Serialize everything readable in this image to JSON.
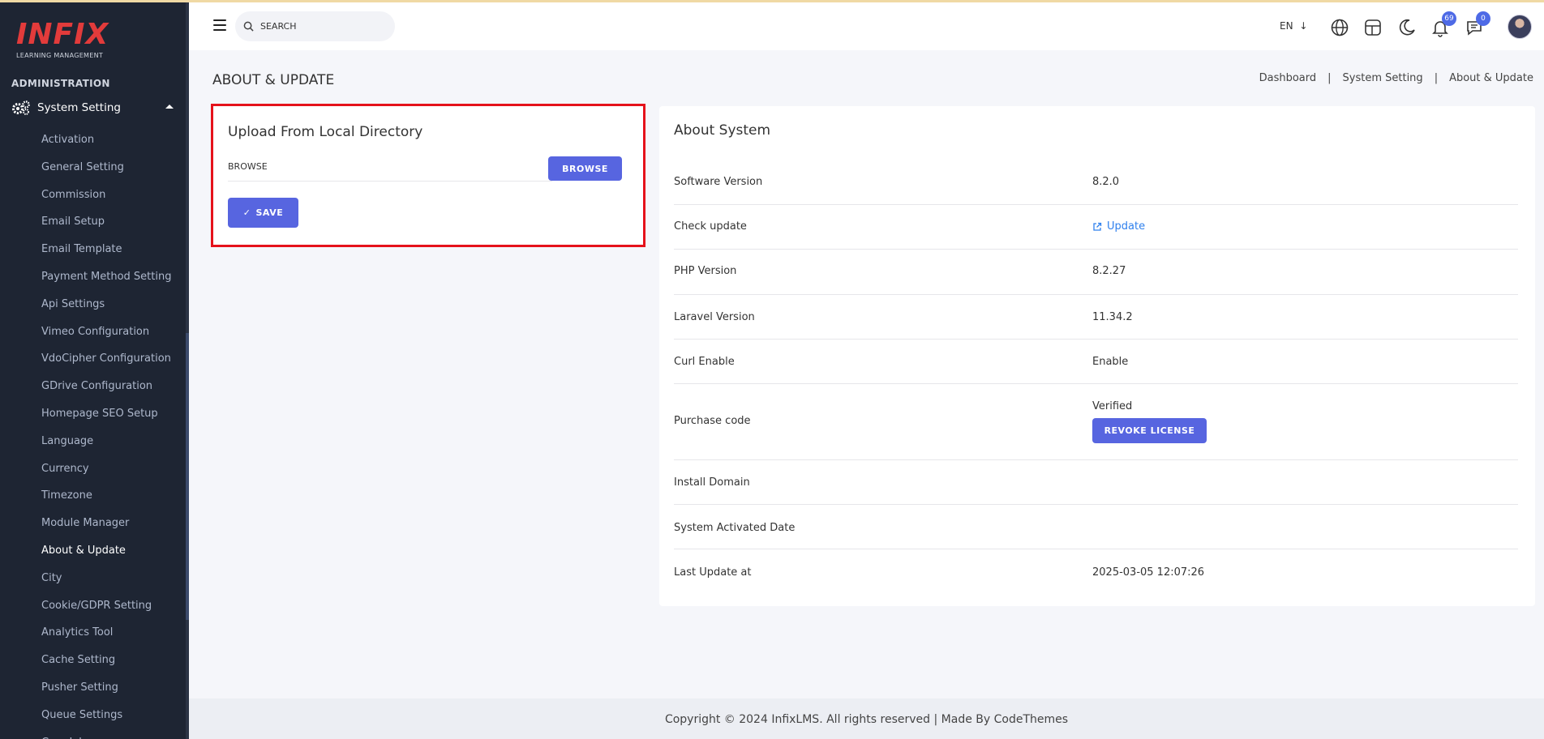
{
  "sidebar": {
    "logo_text": "INFIX",
    "logo_subtitle": "LEARNING MANAGEMENT",
    "section_label": "ADMINISTRATION",
    "parent_item": "System Setting",
    "items": [
      "Activation",
      "General Setting",
      "Commission",
      "Email Setup",
      "Email Template",
      "Payment Method Setting",
      "Api Settings",
      "Vimeo Configuration",
      "VdoCipher Configuration",
      "GDrive Configuration",
      "Homepage SEO Setup",
      "Language",
      "Currency",
      "Timezone",
      "Module Manager",
      "About & Update",
      "City",
      "Cookie/GDPR Setting",
      "Analytics Tool",
      "Cache Setting",
      "Pusher Setting",
      "Queue Settings",
      "Cron Job"
    ],
    "active_item": "About & Update"
  },
  "header": {
    "search_placeholder": "SEARCH",
    "language": "EN",
    "notifications_count": "69",
    "messages_count": "0"
  },
  "page": {
    "title": "ABOUT & UPDATE",
    "breadcrumb": [
      "Dashboard",
      "System Setting",
      "About & Update"
    ]
  },
  "upload": {
    "title": "Upload From Local Directory",
    "browse_label": "BROWSE",
    "browse_button": "BROWSE",
    "save_button": "SAVE"
  },
  "about": {
    "title": "About System",
    "rows": [
      {
        "label": "Software Version",
        "value": "8.2.0"
      },
      {
        "label": "Check update",
        "value": "Update"
      },
      {
        "label": "PHP Version",
        "value": "8.2.27"
      },
      {
        "label": "Laravel Version",
        "value": "11.34.2"
      },
      {
        "label": "Curl Enable",
        "value": "Enable"
      },
      {
        "label": "Purchase code",
        "value": "Verified"
      },
      {
        "label": "Install Domain",
        "value": ""
      },
      {
        "label": "System Activated Date",
        "value": ""
      },
      {
        "label": "Last Update at",
        "value": "2025-03-05 12:07:26"
      }
    ],
    "revoke_button": "REVOKE LICENSE"
  },
  "footer": {
    "text": "Copyright © 2024 InfixLMS. All rights reserved | Made By CodeThemes"
  },
  "colors": {
    "sidebar_bg": "#1e2533",
    "accent": "#5765e0",
    "highlight_border": "#e5121b",
    "link": "#2f80ed"
  }
}
